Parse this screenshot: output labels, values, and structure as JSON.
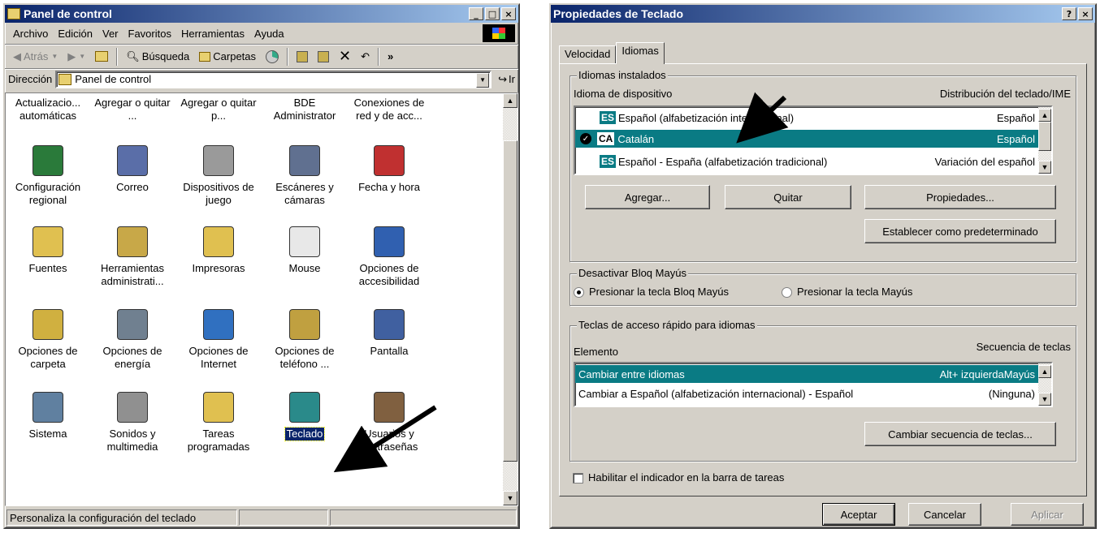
{
  "control_panel": {
    "title": "Panel de control",
    "menu": [
      "Archivo",
      "Edición",
      "Ver",
      "Favoritos",
      "Herramientas",
      "Ayuda"
    ],
    "toolbar": {
      "back": "Atrás",
      "search": "Búsqueda",
      "folders": "Carpetas"
    },
    "address_label": "Dirección",
    "address_value": "Panel de control",
    "go_label": "Ir",
    "items": [
      {
        "label": "Actualizacio... automáticas",
        "icon": "windows-update-icon"
      },
      {
        "label": "Agregar o quitar ...",
        "icon": "add-remove-hardware-icon"
      },
      {
        "label": "Agregar o quitar p...",
        "icon": "add-remove-programs-icon"
      },
      {
        "label": "BDE Administrator",
        "icon": "bde-icon"
      },
      {
        "label": "Conexiones de red y de acc...",
        "icon": "network-icon"
      },
      {
        "label": "Configuración regional",
        "icon": "globe-icon"
      },
      {
        "label": "Correo",
        "icon": "mail-icon"
      },
      {
        "label": "Dispositivos de juego",
        "icon": "joystick-icon"
      },
      {
        "label": "Escáneres y cámaras",
        "icon": "scanner-icon"
      },
      {
        "label": "Fecha y hora",
        "icon": "calendar-clock-icon"
      },
      {
        "label": "Fuentes",
        "icon": "fonts-folder-icon"
      },
      {
        "label": "Herramientas administrati...",
        "icon": "admin-tools-icon"
      },
      {
        "label": "Impresoras",
        "icon": "printers-folder-icon"
      },
      {
        "label": "Mouse",
        "icon": "mouse-icon"
      },
      {
        "label": "Opciones de accesibilidad",
        "icon": "accessibility-icon"
      },
      {
        "label": "Opciones de carpeta",
        "icon": "folder-options-icon"
      },
      {
        "label": "Opciones de energía",
        "icon": "power-icon"
      },
      {
        "label": "Opciones de Internet",
        "icon": "internet-icon"
      },
      {
        "label": "Opciones de teléfono ...",
        "icon": "phone-icon"
      },
      {
        "label": "Pantalla",
        "icon": "display-icon"
      },
      {
        "label": "Sistema",
        "icon": "computer-icon"
      },
      {
        "label": "Sonidos y multimedia",
        "icon": "speaker-icon"
      },
      {
        "label": "Tareas programadas",
        "icon": "scheduled-tasks-icon"
      },
      {
        "label": "Teclado",
        "icon": "keyboard-icon"
      },
      {
        "label": "Usuarios y contraseñas",
        "icon": "users-keys-icon"
      }
    ],
    "status_text": "Personaliza la configuración del teclado"
  },
  "keyboard_props": {
    "title": "Propiedades de Teclado",
    "tabs": [
      "Velocidad",
      "Idiomas"
    ],
    "installed_group": "Idiomas instalados",
    "col_device": "Idioma de dispositivo",
    "col_layout": "Distribución del teclado/IME",
    "languages": [
      {
        "code": "ES",
        "name": "Español (alfabetización internacional)",
        "layout": "Español"
      },
      {
        "code": "CA",
        "name": "Catalán",
        "layout": "Español"
      },
      {
        "code": "ES",
        "name": "Español - España (alfabetización tradicional)",
        "layout": "Variación del español"
      }
    ],
    "btn_add": "Agregar...",
    "btn_remove": "Quitar",
    "btn_properties": "Propiedades...",
    "btn_default": "Establecer como predeterminado",
    "capslock_group": "Desactivar Bloq Mayús",
    "radio_capslock": "Presionar la tecla Bloq Mayús",
    "radio_shift": "Presionar la tecla Mayús",
    "hotkeys_group": "Teclas de acceso rápido para idiomas",
    "col_element": "Elemento",
    "col_sequence": "Secuencia de teclas",
    "hotkeys": [
      {
        "name": "Cambiar entre idiomas",
        "seq": "Alt+ izquierdaMayús"
      },
      {
        "name": "Cambiar a Español (alfabetización internacional) - Español",
        "seq": "(Ninguna)"
      }
    ],
    "btn_change_seq": "Cambiar secuencia de teclas...",
    "taskbar_indicator": "Habilitar el indicador en la barra de tareas",
    "btn_ok": "Aceptar",
    "btn_cancel": "Cancelar",
    "btn_apply": "Aplicar"
  }
}
